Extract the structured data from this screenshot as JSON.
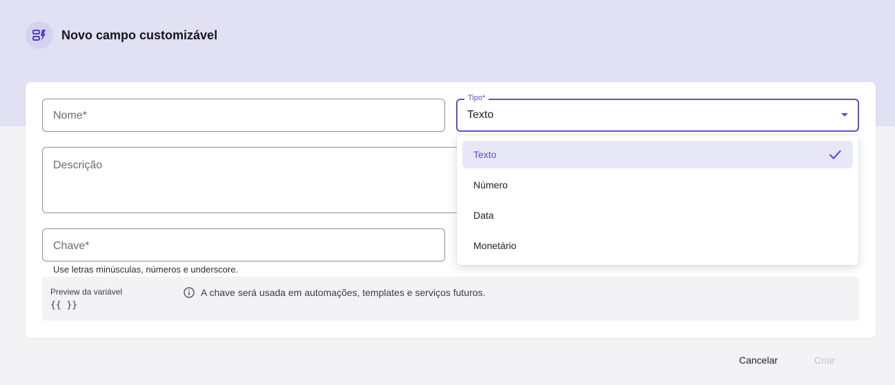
{
  "header": {
    "title": "Novo campo customizável",
    "icon": "custom-field-icon"
  },
  "form": {
    "nome_placeholder": "Nome*",
    "descricao_placeholder": "Descrição",
    "chave_placeholder": "Chave*",
    "chave_helper": "Use letras minúsculas, números e underscore.",
    "tipo": {
      "label": "Tipo*",
      "value": "Texto"
    }
  },
  "preview": {
    "label": "Preview da variável",
    "code": "{{ }}",
    "info": "A chave será usada em automações, templates e serviços futuros."
  },
  "dropdown": {
    "options": [
      {
        "label": "Texto",
        "selected": true
      },
      {
        "label": "Número",
        "selected": false
      },
      {
        "label": "Data",
        "selected": false
      },
      {
        "label": "Monetário",
        "selected": false
      }
    ]
  },
  "footer": {
    "cancel_label": "Cancelar",
    "create_label": "Criar"
  },
  "colors": {
    "accent": "#5b4fd1",
    "header_bg": "#e1e1f3",
    "selected_bg": "#e7e7f7"
  }
}
